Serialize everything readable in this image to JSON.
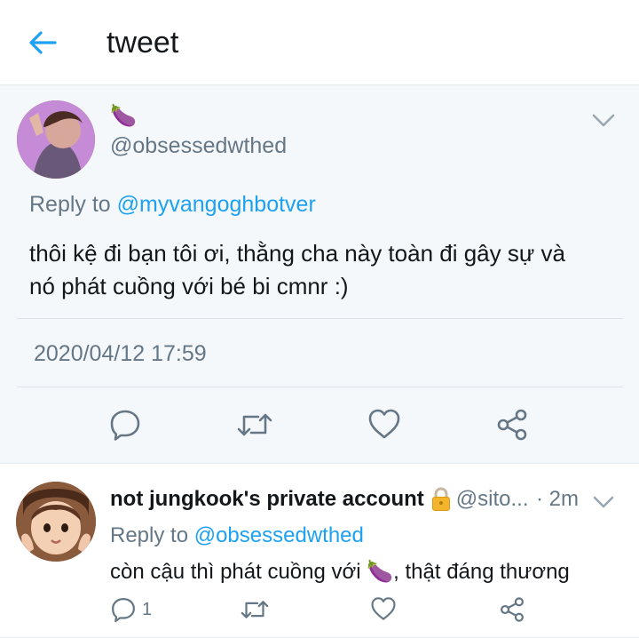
{
  "header": {
    "title": "tweet"
  },
  "main_tweet": {
    "display_name_emoji": "🍆",
    "handle": "@obsessedwthed",
    "reply_prefix": "Reply to",
    "reply_to": "@myvangoghbotver",
    "text_line1": "thôi kệ đi bạn tôi ơi, thằng cha này toàn đi gây sự và",
    "text_line2": "nó phát cuồng với bé bi cmnr :)",
    "timestamp": "2020/04/12 17:59"
  },
  "reply_tweet": {
    "display_name": "not jungkook's private account",
    "handle": "@sito...",
    "time": "· 2m",
    "reply_prefix": "Reply to",
    "reply_to": "@obsessedwthed",
    "text_before_emoji": "còn cậu thì phát cuồng với ",
    "emoji": "🍆",
    "text_after_emoji": ", thật đáng thương",
    "reply_count": "1"
  },
  "colors": {
    "accent": "#1da1f2",
    "secondary_text": "#657786",
    "icon_gray": "#657786",
    "divider": "#e6ecf0"
  },
  "icons": {
    "back": "arrow-left-icon",
    "caret": "chevron-down-icon",
    "reply": "speech-bubble-icon",
    "retweet": "retweet-icon",
    "like": "heart-icon",
    "share": "share-icon",
    "lock": "lock-icon"
  }
}
